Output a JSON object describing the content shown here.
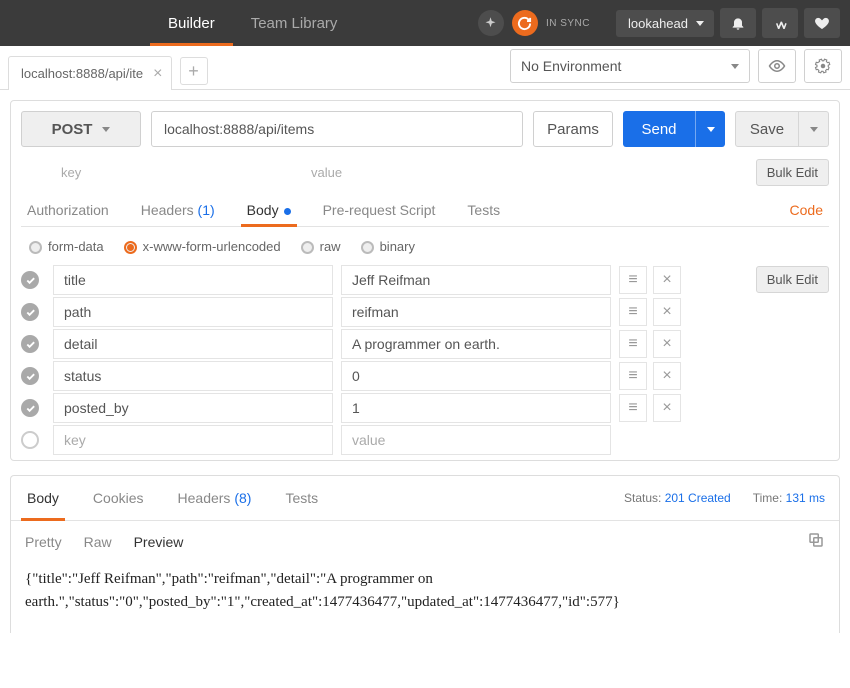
{
  "nav": {
    "builder": "Builder",
    "teamLibrary": "Team Library"
  },
  "sync": "IN SYNC",
  "workspace": "lookahead",
  "tab": {
    "label": "localhost:8888/api/ite"
  },
  "env": {
    "selected": "No Environment"
  },
  "request": {
    "method": "POST",
    "url": "localhost:8888/api/items",
    "paramsBtn": "Params",
    "sendBtn": "Send",
    "saveBtn": "Save",
    "bulkEdit": "Bulk Edit",
    "keyPlaceholder": "key",
    "valuePlaceholder": "value"
  },
  "tabs": {
    "auth": "Authorization",
    "headers": "Headers",
    "headersCount": "(1)",
    "body": "Body",
    "prereq": "Pre-request Script",
    "tests": "Tests",
    "code": "Code"
  },
  "bodyTypes": {
    "formdata": "form-data",
    "urlencoded": "x-www-form-urlencoded",
    "raw": "raw",
    "binary": "binary"
  },
  "params": [
    {
      "key": "title",
      "value": "Jeff Reifman"
    },
    {
      "key": "path",
      "value": "reifman"
    },
    {
      "key": "detail",
      "value": "A programmer on earth."
    },
    {
      "key": "status",
      "value": "0"
    },
    {
      "key": "posted_by",
      "value": "1"
    }
  ],
  "response": {
    "tabs": {
      "body": "Body",
      "cookies": "Cookies",
      "headers": "Headers",
      "headersCount": "(8)",
      "tests": "Tests"
    },
    "statusLabel": "Status:",
    "status": "201 Created",
    "timeLabel": "Time:",
    "time": "131 ms",
    "viewModes": {
      "pretty": "Pretty",
      "raw": "Raw",
      "preview": "Preview"
    },
    "body": "{\"title\":\"Jeff Reifman\",\"path\":\"reifman\",\"detail\":\"A programmer on earth.\",\"status\":\"0\",\"posted_by\":\"1\",\"created_at\":1477436477,\"updated_at\":1477436477,\"id\":577}"
  }
}
